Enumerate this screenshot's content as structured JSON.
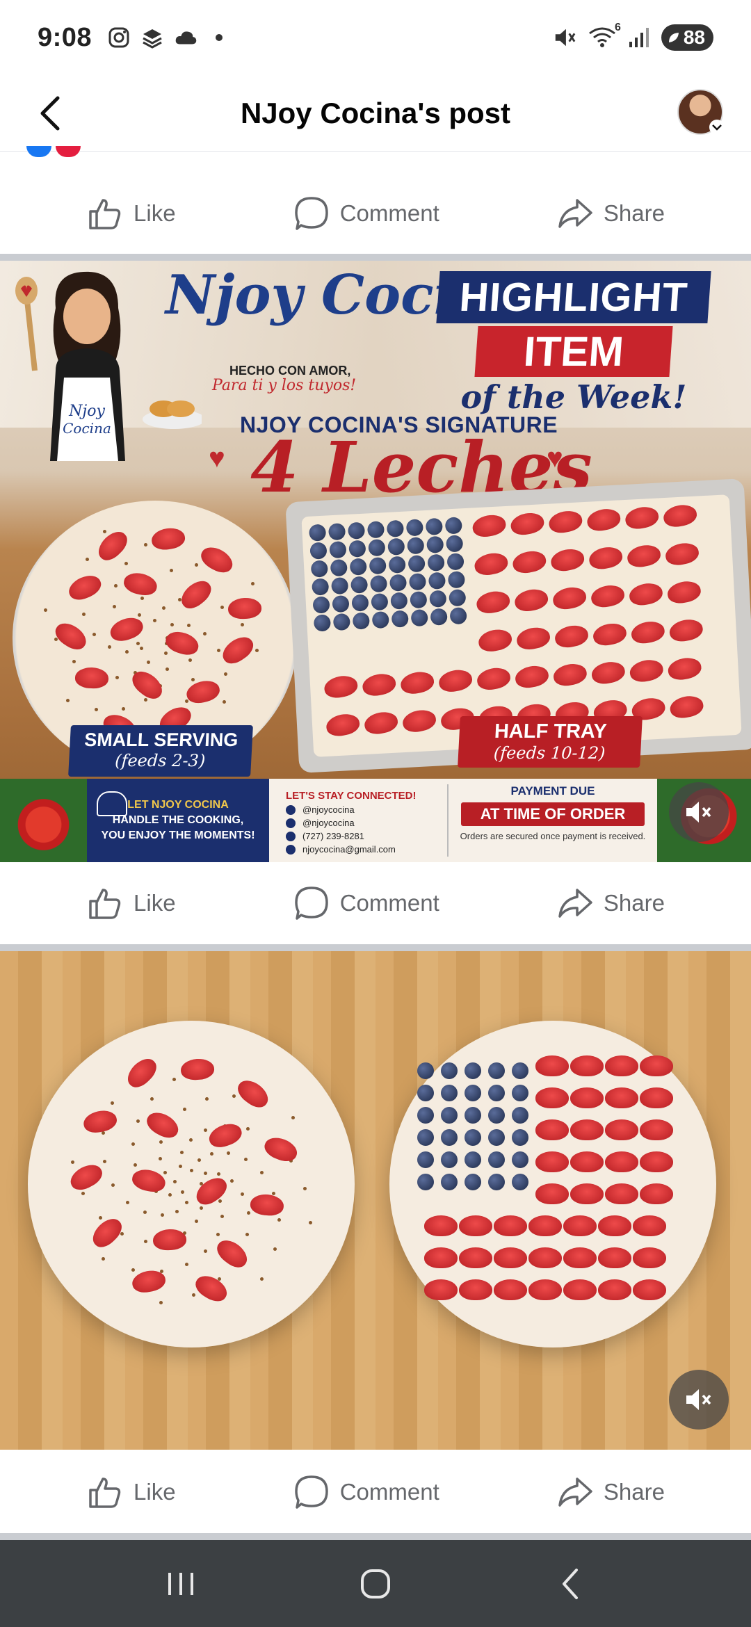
{
  "status_bar": {
    "time": "9:08",
    "left_icons": [
      "instagram-icon",
      "layers-icon",
      "cloud-icon",
      "dot-icon"
    ],
    "right_icons": [
      "mute-icon",
      "wifi-icon",
      "signal-icon"
    ],
    "wifi_label": "6",
    "battery": "88"
  },
  "header": {
    "title": "NJoy Cocina's post",
    "back_icon": "back-arrow-icon"
  },
  "actions": {
    "like": "Like",
    "comment": "Comment",
    "share": "Share"
  },
  "promo": {
    "logo_title": "Njoy Cocina",
    "logo_sub1": "HECHO CON AMOR,",
    "logo_sub2": "Para ti y los tuyos!",
    "apron_text": "Njoy Cocina",
    "highlight1": "HIGHLIGHT",
    "highlight2": "ITEM",
    "highlight3": "of the Week!",
    "signature": "NJOY COCINA'S SIGNATURE",
    "product": "4 Leches",
    "small_label": "SMALL SERVING",
    "small_sub": "(feeds 2-3)",
    "tray_label": "HALF TRAY",
    "tray_sub": "(feeds 10-12)",
    "footer_left_1": "LET NJOY COCINA",
    "footer_left_2": "HANDLE THE COOKING,",
    "footer_left_3": "YOU ENJOY THE MOMENTS!",
    "footer_mid_heading": "LET'S STAY CONNECTED!",
    "footer_contacts": [
      "@njoycocina",
      "@njoycocina",
      "(727) 239-8281",
      "njoycocina@gmail.com"
    ],
    "footer_right_1": "PAYMENT DUE",
    "footer_right_2": "AT TIME OF ORDER",
    "footer_right_3": "Orders are secured once payment is received."
  },
  "colors": {
    "navy": "#1b2f6e",
    "red": "#b81f25",
    "action_gray": "#65676b",
    "nav_bar": "#3c4043"
  }
}
